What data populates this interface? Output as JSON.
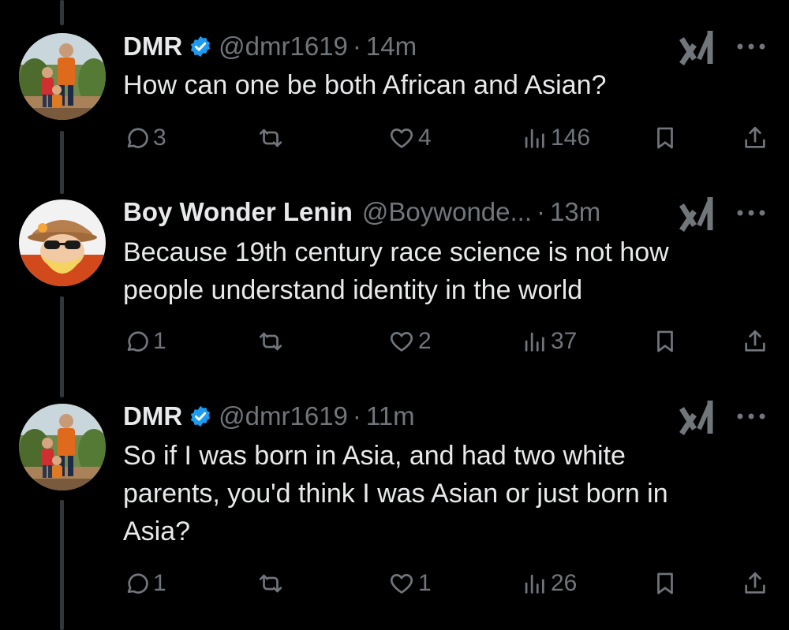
{
  "colors": {
    "background": "#000000",
    "text": "#e7e9ea",
    "muted": "#71767b",
    "verified": "#1d9bf0",
    "thread_line": "#333639"
  },
  "tweets": [
    {
      "name": "DMR",
      "verified": true,
      "handle": "@dmr1619",
      "separator": "·",
      "time": "14m",
      "lines": [
        "How can one be both African and Asian?"
      ],
      "actions": {
        "replies": "3",
        "reposts": "",
        "likes": "4",
        "views": "146"
      },
      "avatar_icon": "dmr-avatar-photo"
    },
    {
      "name": "Boy Wonder Lenin",
      "verified": false,
      "handle": "@Boywonde...",
      "separator": "·",
      "time": "13m",
      "lines": [
        "Because 19th century race science is not how",
        "people understand identity in the world"
      ],
      "actions": {
        "replies": "1",
        "reposts": "",
        "likes": "2",
        "views": "37"
      },
      "avatar_icon": "bearded-cartoon-avatar"
    },
    {
      "name": "DMR",
      "verified": true,
      "handle": "@dmr1619",
      "separator": "·",
      "time": "11m",
      "lines": [
        "So if I was born in Asia, and had two white",
        "parents, you'd think I was Asian or just born in",
        "Asia?"
      ],
      "actions": {
        "replies": "1",
        "reposts": "",
        "likes": "1",
        "views": "26"
      },
      "avatar_icon": "dmr-avatar-photo"
    }
  ]
}
